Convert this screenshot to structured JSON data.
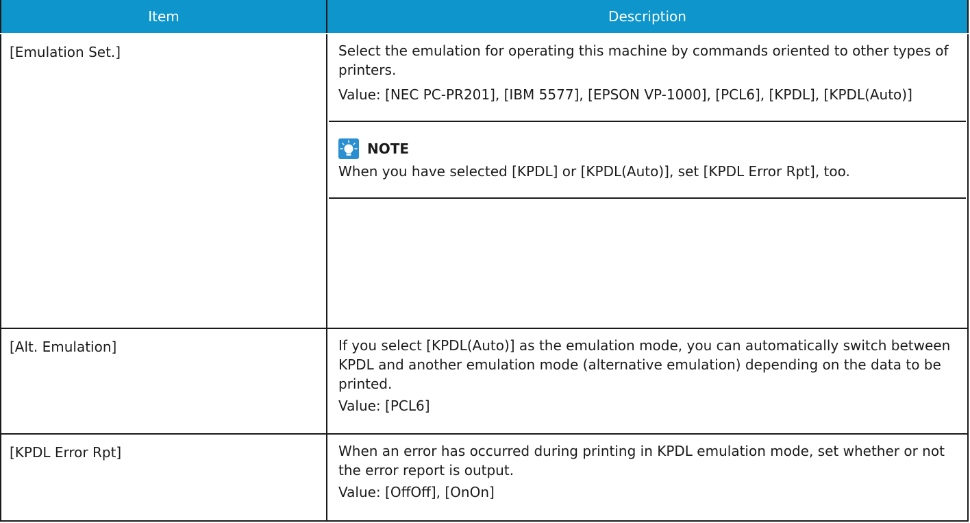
{
  "header": {
    "item": "Item",
    "description": "Description"
  },
  "rows": [
    {
      "item": "[Emulation Set.]",
      "description": "Select the emulation for operating this machine by commands oriented to other types of printers.",
      "value": "Value: [NEC PC-PR201], [IBM 5577], [EPSON VP-1000], [PCL6], [KPDL], [KPDL(Auto)]",
      "note": {
        "icon": "lightbulb-note-icon",
        "title": "NOTE",
        "text": "When you have selected [KPDL] or [KPDL(Auto)], set [KPDL Error Rpt], too."
      }
    },
    {
      "item": "[Alt. Emulation]",
      "description": "If you select [KPDL(Auto)] as the emulation mode, you can automatically switch between KPDL and another emulation mode (alternative emulation) depending on the data to be printed.",
      "value": "Value: [PCL6]"
    },
    {
      "item": "[KPDL Error Rpt]",
      "description": "When an error has occurred during printing in KPDL emulation mode, set whether or not the error report is output.",
      "value": "Value: [OffOff], [OnOn]"
    }
  ],
  "colors": {
    "header_bg": "#0e96cc",
    "note_icon_bg": "#2a8fd0"
  }
}
